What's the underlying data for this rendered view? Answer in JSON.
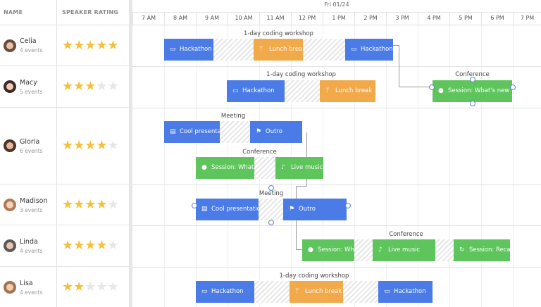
{
  "columns": {
    "name": "NAME",
    "rating": "SPEAKER RATING"
  },
  "timeline": {
    "date": "Fri 01/24",
    "hours": [
      "7 AM",
      "8 AM",
      "9 AM",
      "10 AM",
      "11 AM",
      "12 PM",
      "1 PM",
      "2 PM",
      "3 PM",
      "4 PM",
      "5 PM",
      "6 PM",
      "7 PM"
    ]
  },
  "speakers": [
    {
      "name": "Celia",
      "events": "4 events",
      "rating": 5
    },
    {
      "name": "Macy",
      "events": "5 events",
      "rating": 3
    },
    {
      "name": "Gloria",
      "events": "6 events",
      "rating": 4
    },
    {
      "name": "Madison",
      "events": "3 events",
      "rating": 4
    },
    {
      "name": "Linda",
      "events": "4 events",
      "rating": 4
    },
    {
      "name": "Lisa",
      "events": "4 events",
      "rating": 2
    }
  ],
  "groups": {
    "workshop": "1-day coding workshop",
    "conference": "Conference",
    "meeting": "Meeting"
  },
  "events": {
    "hackathon": "Hackathon",
    "lunch": "Lunch break",
    "session_whats_new": "Session: What's new",
    "cool_presentation": "Cool presentation",
    "outro": "Outro",
    "session_what": "Session: What's new",
    "live_music": "Live music",
    "session_recap": "Session: Recap"
  },
  "colors": {
    "blue": "#4a7be7",
    "orange": "#f2a94a",
    "green": "#5ec45c",
    "star": "#f5c13b"
  },
  "icons": {
    "hackathon": "laptop-icon",
    "lunch": "utensils-icon",
    "session": "info-icon",
    "presentation": "document-icon",
    "outro": "flag-icon",
    "music": "guitar-icon",
    "recap": "refresh-icon"
  }
}
